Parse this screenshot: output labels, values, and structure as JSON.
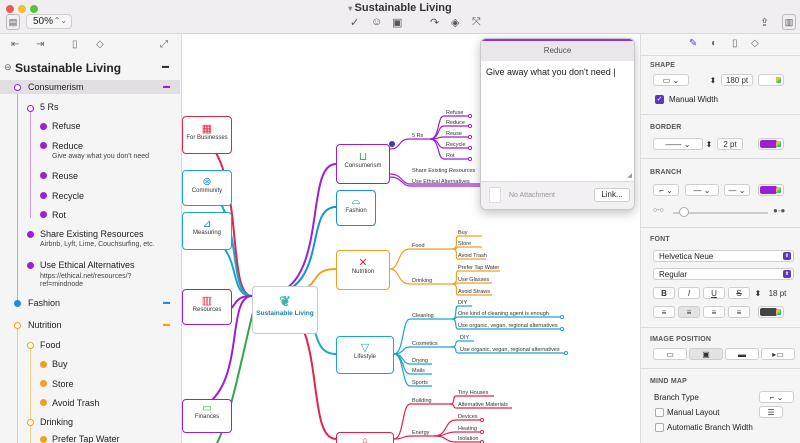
{
  "window": {
    "title": "Sustainable Living",
    "zoom": "50%"
  },
  "colors": {
    "accent": "#5a39c7",
    "branch_purple": "#9b1fd6",
    "orange": "#f0a020",
    "blue": "#1aa7c9",
    "red": "#e0244a",
    "green": "#2ca84a"
  },
  "outline": {
    "title": "Sustainable Living",
    "items": [
      {
        "label": "Consumerism"
      },
      {
        "label": "5 Rs"
      },
      {
        "label": "Refuse"
      },
      {
        "label": "Reduce",
        "note": "Give away what you don't need"
      },
      {
        "label": "Reuse"
      },
      {
        "label": "Recycle"
      },
      {
        "label": "Rot"
      },
      {
        "label": "Share Existing Resources",
        "note": "Airbnb, Lyft, Lime, Couchsurfing, etc."
      },
      {
        "label": "Use Ethical Alternatives",
        "note1": "https://ethical.net/resources/?",
        "note2": "ref=mindnode"
      },
      {
        "label": "Fashion"
      },
      {
        "label": "Nutrition"
      },
      {
        "label": "Food"
      },
      {
        "label": "Buy"
      },
      {
        "label": "Store"
      },
      {
        "label": "Avoid Trash"
      },
      {
        "label": "Drinking"
      },
      {
        "label": "Prefer Tap Water"
      }
    ]
  },
  "map": {
    "root": "Sustainable Living",
    "nodes": {
      "consumerism": "Consumerism",
      "fashion": "Fashion",
      "nutrition": "Nutrition",
      "lifestyle": "Lifestyle",
      "businesses": "For Businesses",
      "community": "Community",
      "measuring": "Measuring",
      "resources": "Resources",
      "finances": "Finances"
    },
    "labels": {
      "five_rs": "5 Rs",
      "refuse": "Refuse",
      "reduce": "Reduce",
      "reuse": "Reuse",
      "recycle": "Recycle",
      "rot": "Rot",
      "share": "Share Existing Resources",
      "ethical": "Use Ethical Alternatives",
      "food": "Food",
      "buy": "Buy",
      "store": "Store",
      "avoid_trash": "Avoid Trash",
      "drinking": "Drinking",
      "tap": "Prefer Tap Water",
      "glasses": "Use Glasses",
      "straws": "Avoid Straws",
      "cleaning": "Cleaning",
      "diy": "DIY",
      "one_kind": "One kind of cleaning agent is enough",
      "organic": "Use organic, vegan, regional alternatives",
      "cosmetics": "Cosmetics",
      "diy2": "DIY",
      "organic2": "Use organic, vegan, regional alternatives",
      "drying": "Drying",
      "mails": "Mails",
      "sports": "Sports",
      "building": "Building",
      "tiny": "Tiny Houses",
      "alt_mat": "Alternative Materials",
      "energy": "Energy",
      "devices": "Devices",
      "heating": "Heating",
      "isolation": "Isolation"
    }
  },
  "popup": {
    "title": "Reduce",
    "text": "Give away what you don't need",
    "attachment": "No Attachment",
    "link_button": "Link..."
  },
  "inspector": {
    "shape": {
      "header": "SHAPE",
      "width": "180 pt",
      "manual_width": "Manual Width"
    },
    "border": {
      "header": "BORDER",
      "width": "2 pt"
    },
    "branch": {
      "header": "BRANCH"
    },
    "font": {
      "header": "FONT",
      "family": "Helvetica Neue",
      "style": "Regular",
      "size": "18 pt",
      "bold": "B",
      "italic": "I",
      "underline": "U",
      "strike": "S"
    },
    "image_position": {
      "header": "IMAGE POSITION"
    },
    "mind_map": {
      "header": "MIND MAP",
      "branch_type": "Branch Type",
      "manual_layout": "Manual Layout",
      "auto_branch_width": "Automatic Branch Width"
    }
  }
}
